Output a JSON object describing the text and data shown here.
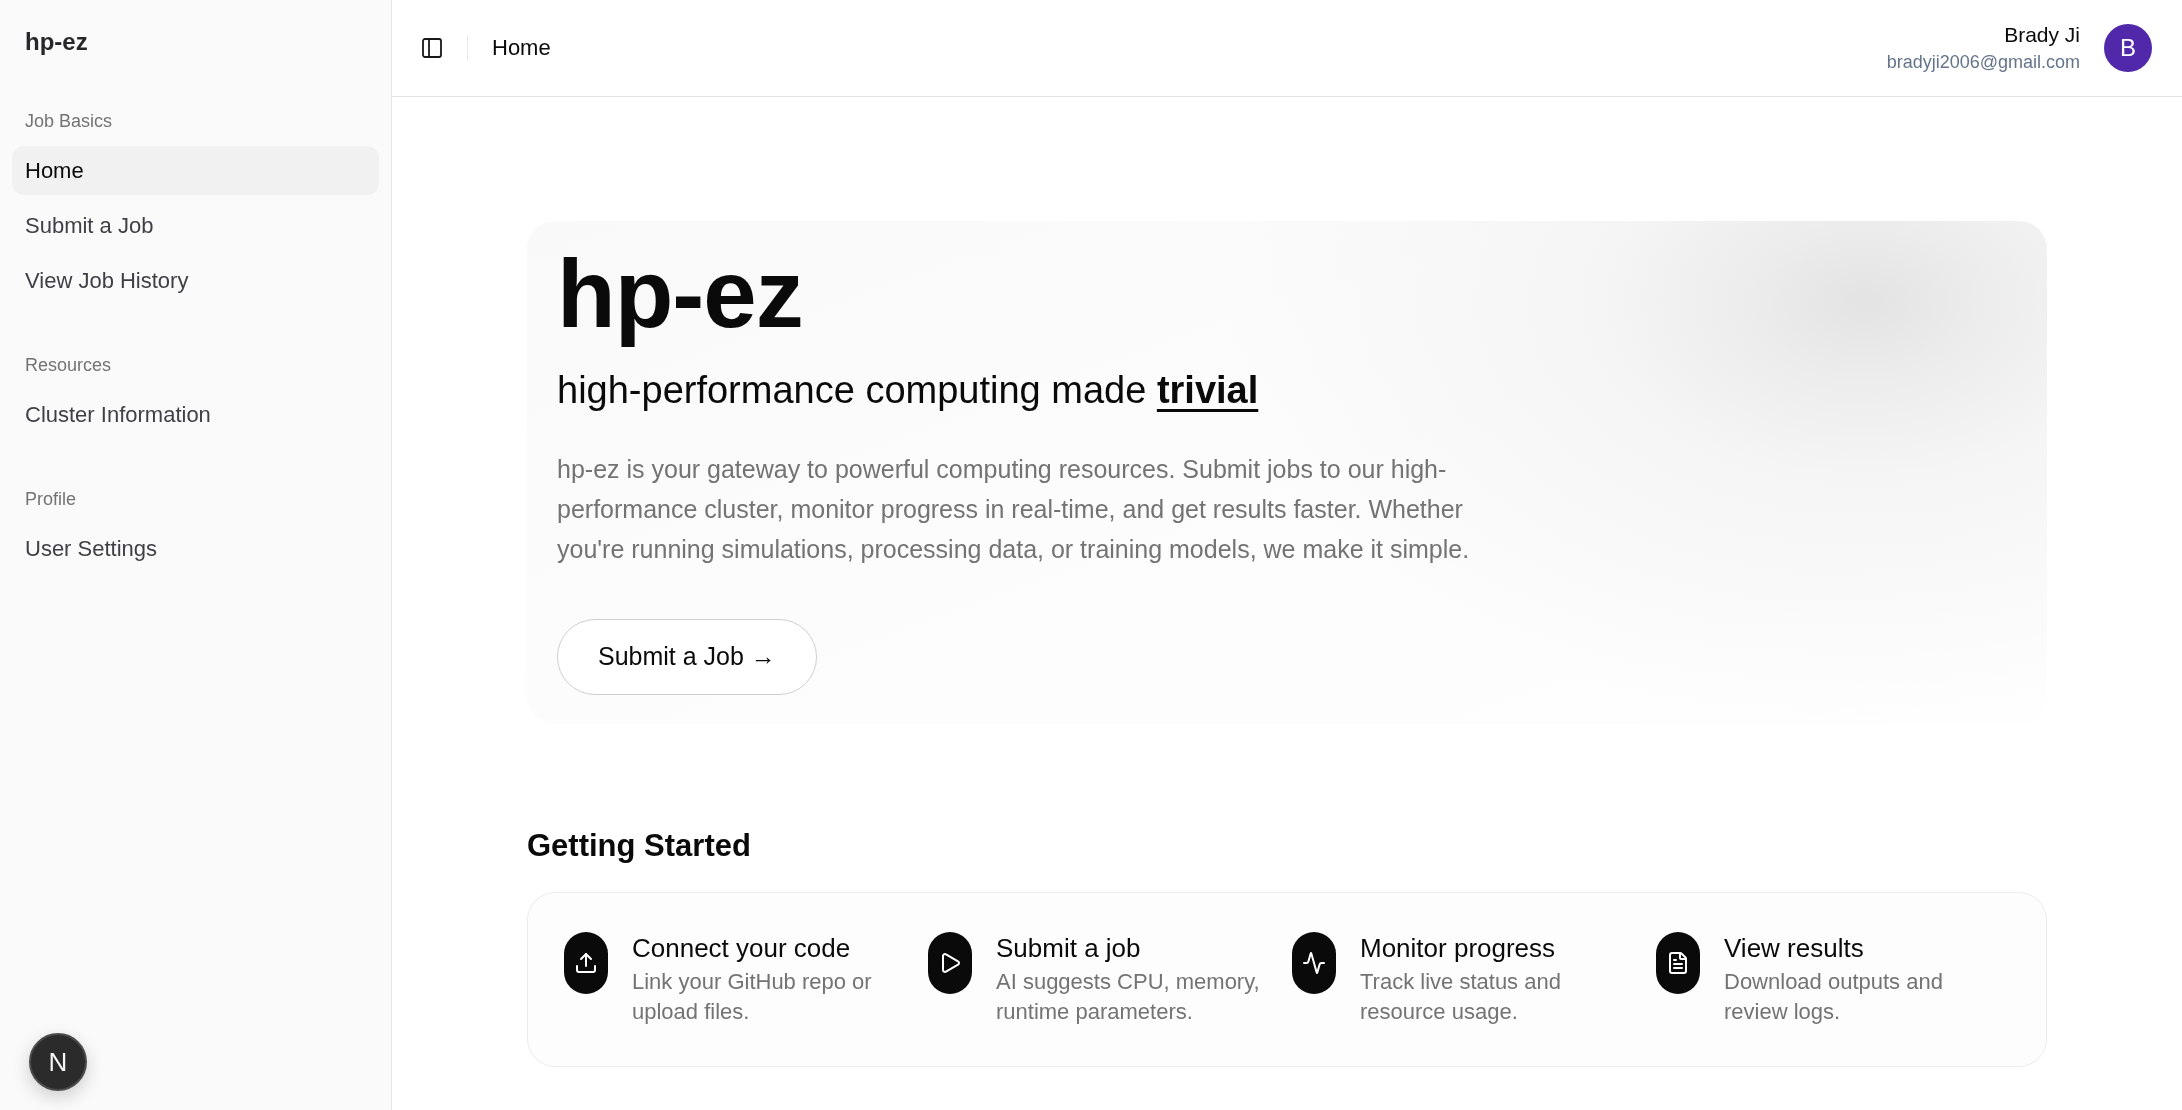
{
  "sidebar": {
    "logo": "hp-ez",
    "groups": [
      {
        "title": "Job Basics",
        "items": [
          {
            "label": "Home",
            "selected": true
          },
          {
            "label": "Submit a Job",
            "selected": false
          },
          {
            "label": "View Job History",
            "selected": false
          }
        ]
      },
      {
        "title": "Resources",
        "items": [
          {
            "label": "Cluster Information",
            "selected": false
          }
        ]
      },
      {
        "title": "Profile",
        "items": [
          {
            "label": "User Settings",
            "selected": false
          }
        ]
      }
    ],
    "dev_indicator": {
      "label": "N"
    }
  },
  "header": {
    "breadcrumb": "Home",
    "user": {
      "name": "Brady Ji",
      "email": "bradyji2006@gmail.com",
      "avatar_initial": "B"
    }
  },
  "hero": {
    "title": "hp-ez",
    "tagline": "high-performance computing made **trivial**",
    "description": "hp-ez is your gateway to powerful computing resources. Submit jobs to our high-performance cluster, monitor progress in real-time, and get results faster. Whether you're running simulations, processing data, or training models, we make it simple.",
    "button": "Submit a Job →"
  },
  "getting_started": {
    "title": "Getting Started",
    "steps": [
      {
        "kind": "upload",
        "title": "Connect your code",
        "description": "Link your GitHub repo or upload files."
      },
      {
        "kind": "play",
        "title": "Submit a job",
        "description": "AI suggests CPU, memory, runtime parameters."
      },
      {
        "kind": "activity",
        "title": "Monitor progress",
        "description": "Track live status and resource usage."
      },
      {
        "kind": "document",
        "title": "View results",
        "description": "Download outputs and review logs."
      }
    ]
  }
}
